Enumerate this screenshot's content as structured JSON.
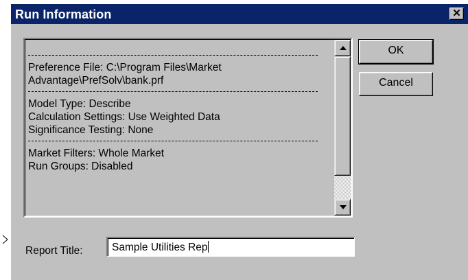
{
  "dialog": {
    "title": "Run Information",
    "close_glyph": "✕"
  },
  "run_info": {
    "preference_line1": "Preference File: C:\\Program Files\\Market",
    "preference_line2": "Advantage\\PrefSolv\\bank.prf",
    "model_type": "Model Type: Describe",
    "calculation_settings": "Calculation Settings: Use Weighted Data",
    "significance_testing": "Significance Testing: None",
    "market_filters": "Market Filters: Whole Market",
    "run_groups": "Run Groups: Disabled"
  },
  "buttons": {
    "ok": "OK",
    "cancel": "Cancel"
  },
  "report": {
    "label": "Report Title:",
    "value": "Sample Utilities Rep"
  },
  "colors": {
    "titlebar": "#0a246a",
    "face": "#c0c0c0"
  }
}
